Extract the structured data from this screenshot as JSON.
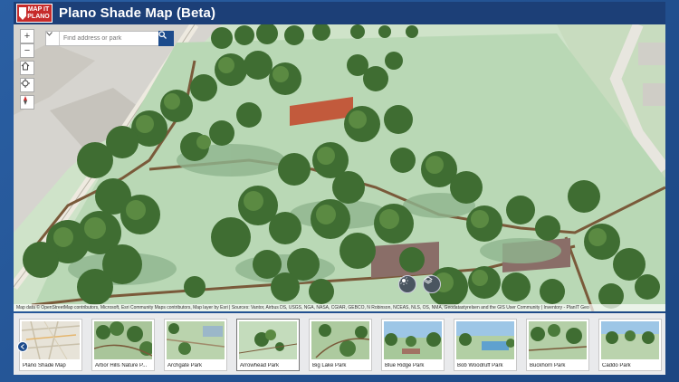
{
  "app": {
    "title": "Plano Shade Map (Beta)",
    "logo": "MAP IT PLANO",
    "brand_color": "#1c3f77",
    "accent_color": "#c62b2b"
  },
  "search": {
    "placeholder": "Find address or park",
    "dropdown_icon": "chevron-down-icon",
    "button_icon": "search-icon"
  },
  "map_controls": {
    "zoom_in": "+",
    "zoom_out": "−",
    "home_icon": "home-icon",
    "locate_icon": "locate-icon",
    "compass_icon": "compass-icon",
    "daylight_icon": "sun-icon",
    "layers_icon": "layers-icon"
  },
  "attribution": "Map data © OpenStreetMap contributors, Microsoft, Esri Community Maps contributors, Map layer by Esri | Sources: Vantor, Airbus DS, USGS, NGA, NASA, CGIAR, GEBCO, N Robinson, NCEAS, NLS, OS, NMA, Geodatastyrelsen and the GIS User Community | Inventory - PlanIT Geo",
  "parks": [
    {
      "name": "Plano Shade Map"
    },
    {
      "name": "Arbor Hills Nature P..."
    },
    {
      "name": "Archgate Park"
    },
    {
      "name": "Arrowhead Park"
    },
    {
      "name": "Big Lake Park"
    },
    {
      "name": "Blue Ridge Park"
    },
    {
      "name": "Bob Woodruff Park"
    },
    {
      "name": "Buckhorn Park"
    },
    {
      "name": "Caddo Park"
    }
  ],
  "selected_park": "Arrowhead Park"
}
